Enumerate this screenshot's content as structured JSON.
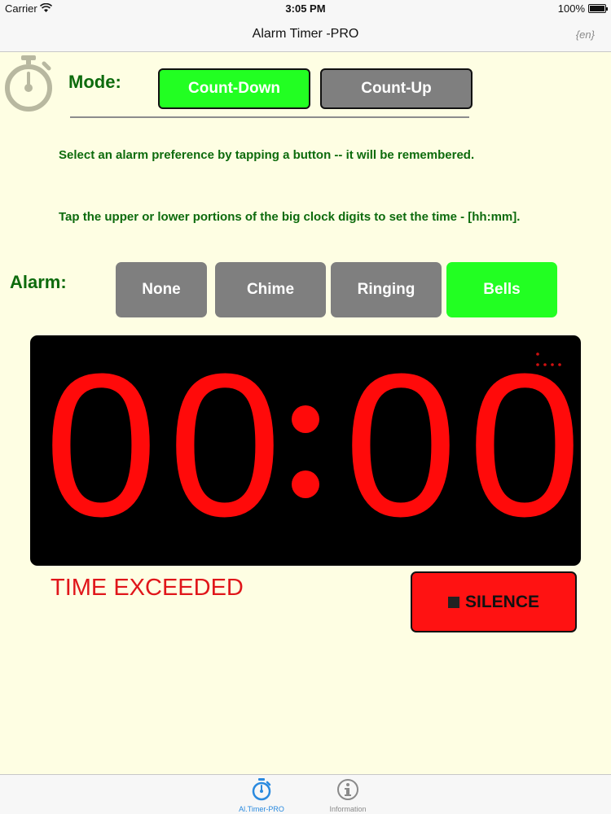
{
  "status_bar": {
    "carrier": "Carrier",
    "time": "3:05 PM",
    "battery": "100%"
  },
  "nav": {
    "title": "Alarm Timer -PRO",
    "language": "{en}"
  },
  "mode": {
    "label": "Mode:",
    "buttons": [
      {
        "label": "Count-Down",
        "selected": true
      },
      {
        "label": "Count-Up",
        "selected": false
      }
    ]
  },
  "instructions": [
    "Select an alarm preference by tapping a button -- it will be remembered.",
    "Tap the upper or lower portions of the big clock digits to set the time - [hh:mm]."
  ],
  "alarm": {
    "label": "Alarm:",
    "options": [
      {
        "label": "None",
        "selected": false
      },
      {
        "label": "Chime",
        "selected": false
      },
      {
        "label": "Ringing",
        "selected": false
      },
      {
        "label": "Bells",
        "selected": true
      }
    ]
  },
  "clock": {
    "digits": [
      "0",
      "0",
      "0",
      "0"
    ],
    "separator": ":",
    "digit_color": "#ff0a0a"
  },
  "status": {
    "message": "TIME EXCEEDED",
    "silence_label": "SILENCE"
  },
  "tab_bar": {
    "tabs": [
      {
        "label": "Al.Timer-PRO",
        "icon": "stopwatch-icon",
        "active": true
      },
      {
        "label": "Information",
        "icon": "info-icon",
        "active": false
      }
    ]
  },
  "colors": {
    "background": "#fefee3",
    "accent_green": "#22ff22",
    "label_green": "#0d6b0d",
    "inactive_gray": "#7f7f7f",
    "alarm_red": "#ff1212",
    "tab_blue": "#2a8adf"
  }
}
